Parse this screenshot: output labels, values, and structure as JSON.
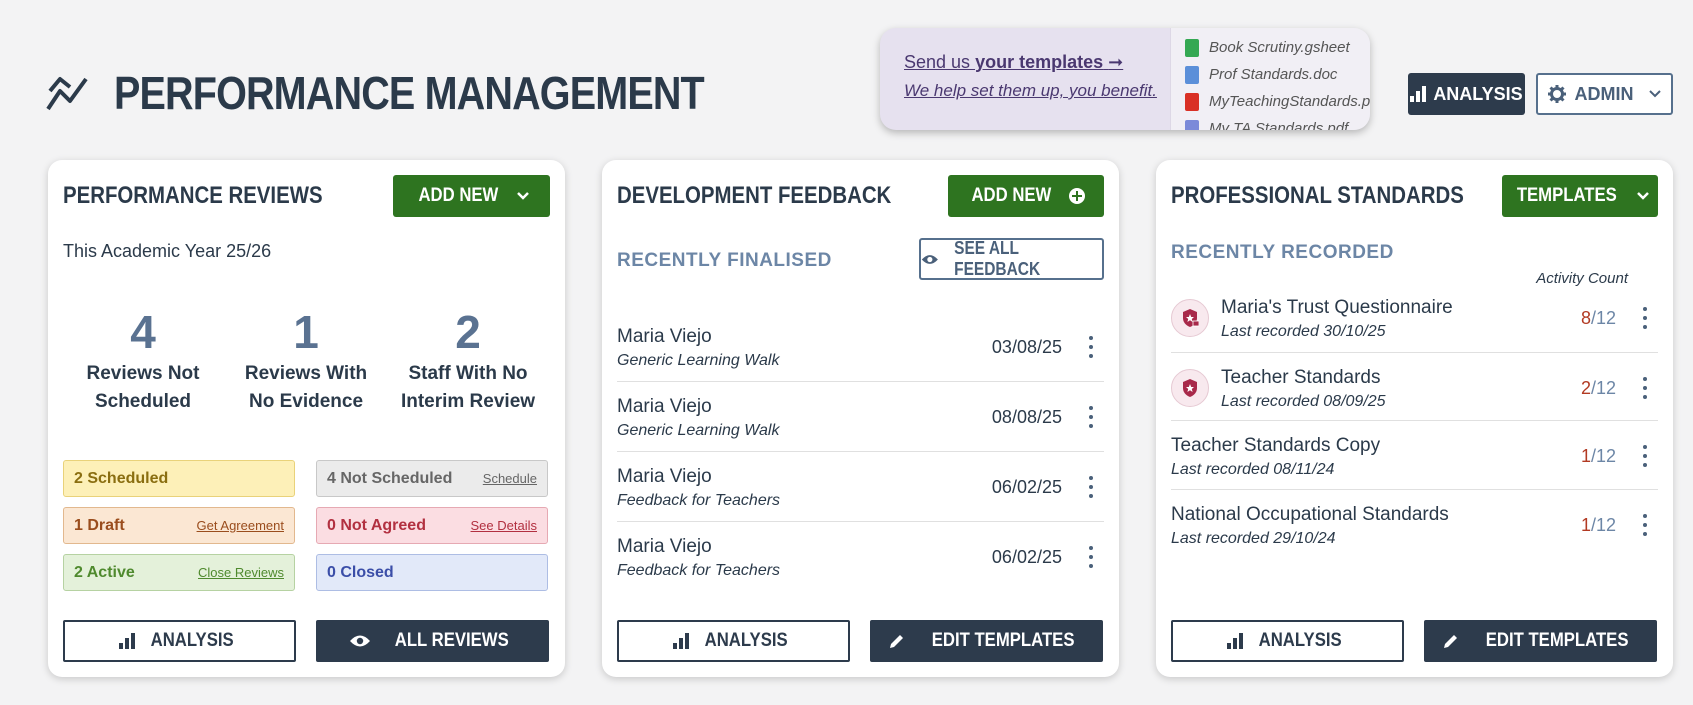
{
  "page": {
    "title": "PERFORMANCE MANAGEMENT"
  },
  "promo": {
    "line1_prefix": "Send us ",
    "line1_bold": "your templates",
    "line1_arrow": "➞",
    "line2": "We help set them up, you benefit.",
    "files": [
      {
        "name": "Book Scrutiny.gsheet",
        "color": "#34a853"
      },
      {
        "name": "Prof Standards.doc",
        "color": "#5b8fd9"
      },
      {
        "name": "MyTeachingStandards.pdf",
        "color": "#d93025"
      },
      {
        "name": "My TA Standards.pdf",
        "color": "#7b8ad9"
      }
    ]
  },
  "top_buttons": {
    "analysis": "ANALYSIS",
    "admin": "ADMIN"
  },
  "reviews": {
    "title": "PERFORMANCE REVIEWS",
    "add_new": "ADD NEW",
    "year": "This Academic Year 25/26",
    "stats": [
      {
        "num": "4",
        "line1": "Reviews Not",
        "line2": "Scheduled"
      },
      {
        "num": "1",
        "line1": "Reviews With",
        "line2": "No Evidence"
      },
      {
        "num": "2",
        "line1": "Staff With No",
        "line2": "Interim Review"
      }
    ],
    "badges": {
      "scheduled": {
        "label": "2 Scheduled"
      },
      "not_scheduled": {
        "label": "4 Not Scheduled",
        "action": "Schedule"
      },
      "draft": {
        "label": "1 Draft",
        "action": "Get Agreement"
      },
      "not_agreed": {
        "label": "0 Not Agreed",
        "action": "See Details"
      },
      "active": {
        "label": "2 Active",
        "action": "Close Reviews"
      },
      "closed": {
        "label": "0 Closed"
      }
    },
    "analysis": "ANALYSIS",
    "all_reviews": "ALL REVIEWS"
  },
  "feedback": {
    "title": "DEVELOPMENT FEEDBACK",
    "add_new": "ADD NEW",
    "sub": "RECENTLY FINALISED",
    "see_all": "SEE ALL FEEDBACK",
    "items": [
      {
        "name": "Maria Viejo",
        "desc": "Generic Learning Walk",
        "date": "03/08/25"
      },
      {
        "name": "Maria Viejo",
        "desc": "Generic Learning Walk",
        "date": "08/08/25"
      },
      {
        "name": "Maria Viejo",
        "desc": "Feedback for Teachers",
        "date": "06/02/25"
      },
      {
        "name": "Maria Viejo",
        "desc": "Feedback for Teachers",
        "date": "06/02/25"
      }
    ],
    "analysis": "ANALYSIS",
    "edit": "EDIT TEMPLATES"
  },
  "standards": {
    "title": "PROFESSIONAL STANDARDS",
    "templates": "TEMPLATES",
    "sub": "RECENTLY RECORDED",
    "activity": "Activity Count",
    "items": [
      {
        "name": "Maria's Trust Questionnaire",
        "desc": "Last recorded 30/10/25",
        "done": "8",
        "total": "/12"
      },
      {
        "name": "Teacher Standards",
        "desc": "Last recorded 08/09/25",
        "done": "2",
        "total": "/12"
      },
      {
        "name": "Teacher Standards Copy",
        "desc": "Last recorded 08/11/24",
        "done": "1",
        "total": "/12"
      },
      {
        "name": "National Occupational Standards",
        "desc": "Last recorded 29/10/24",
        "done": "1",
        "total": "/12"
      }
    ],
    "analysis": "ANALYSIS",
    "edit": "EDIT TEMPLATES"
  }
}
